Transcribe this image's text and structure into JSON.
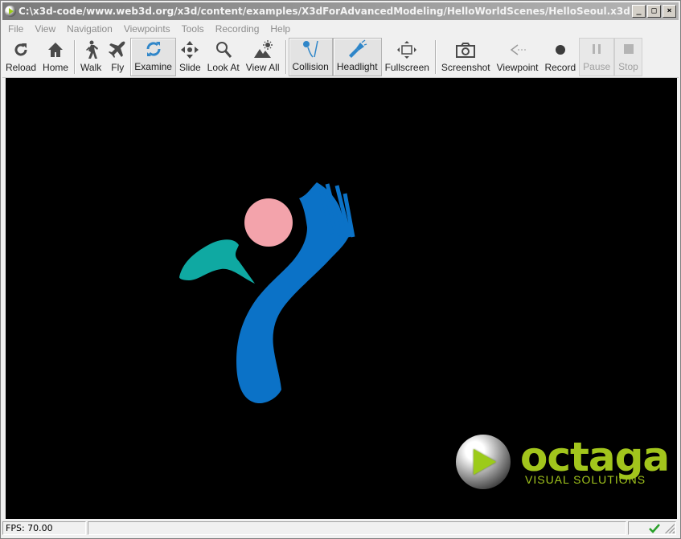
{
  "window": {
    "title": "C:\\x3d-code/www.web3d.org/x3d/content/examples/X3dForAdvancedModeling/HelloWorldScenes/HelloSeoul.x3d - Oct...",
    "minimize": "_",
    "maximize": "□",
    "close": "×"
  },
  "menu": [
    "File",
    "View",
    "Navigation",
    "Viewpoints",
    "Tools",
    "Recording",
    "Help"
  ],
  "toolbar": {
    "reload": "Reload",
    "home": "Home",
    "walk": "Walk",
    "fly": "Fly",
    "examine": "Examine",
    "slide": "Slide",
    "look_at": "Look At",
    "view_all": "View All",
    "collision": "Collision",
    "headlight": "Headlight",
    "fullscreen": "Fullscreen",
    "screenshot": "Screenshot",
    "viewpoint": "Viewpoint",
    "record": "Record",
    "pause": "Pause",
    "stop": "Stop"
  },
  "scene": {
    "background": "#000000",
    "emblem_colors": {
      "pink": "#f3a3ab",
      "teal": "#0fa9a2",
      "blue": "#0b72c7"
    }
  },
  "logo": {
    "name": "octaga",
    "tagline": "VISUAL SOLUTIONS",
    "color": "#a2c51c"
  },
  "status": {
    "fps": "FPS: 70.00",
    "ok_icon": "check-icon"
  }
}
